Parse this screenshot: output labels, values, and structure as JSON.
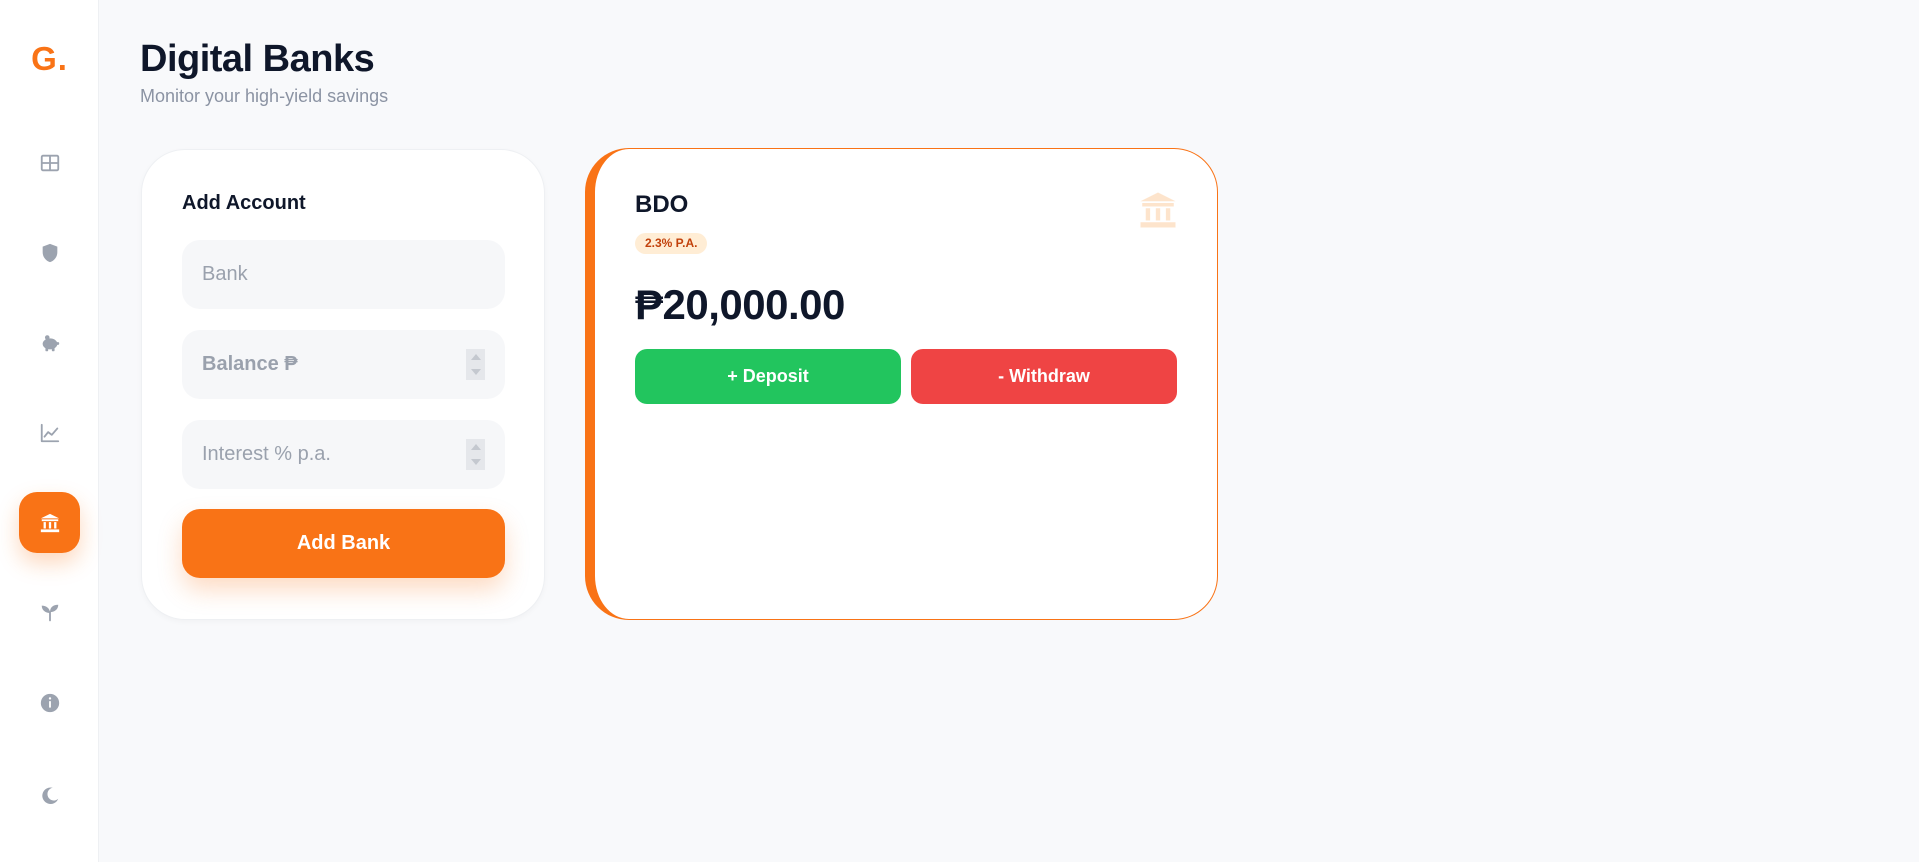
{
  "sidebar": {
    "logo": "G.",
    "items": [
      {
        "icon": "grid-icon",
        "active": false
      },
      {
        "icon": "shield-icon",
        "active": false
      },
      {
        "icon": "piggy-bank-icon",
        "active": false
      },
      {
        "icon": "chart-line-icon",
        "active": false
      },
      {
        "icon": "bank-icon",
        "active": true
      },
      {
        "icon": "seedling-icon",
        "active": false
      },
      {
        "icon": "info-icon",
        "active": false
      },
      {
        "icon": "moon-icon",
        "active": false
      }
    ]
  },
  "header": {
    "title": "Digital Banks",
    "subtitle": "Monitor your high-yield savings"
  },
  "add_account": {
    "title": "Add Account",
    "bank_placeholder": "Bank",
    "balance_placeholder": "Balance ₱",
    "interest_placeholder": "Interest % p.a.",
    "button_label": "Add Bank"
  },
  "accounts": [
    {
      "name": "BDO",
      "rate": "2.3% P.A.",
      "balance": "₱20,000.00",
      "deposit_label": "+ Deposit",
      "withdraw_label": "- Withdraw"
    }
  ],
  "colors": {
    "accent": "#f97316",
    "deposit": "#22c55e",
    "withdraw": "#ef4444",
    "text": "#0f172a"
  }
}
